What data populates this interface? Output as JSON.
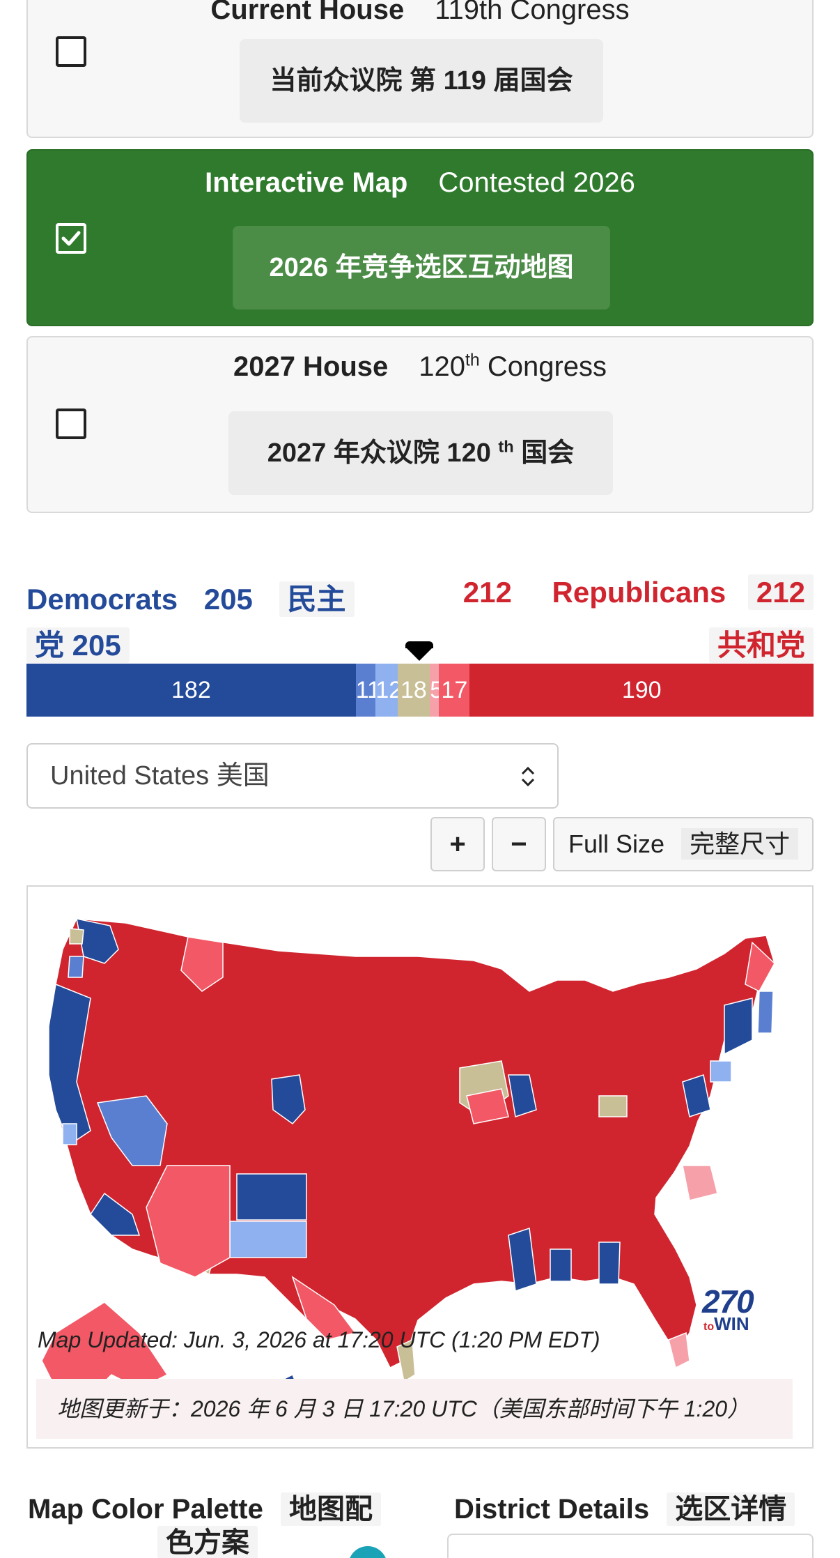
{
  "cards": [
    {
      "title_bold": "Current House",
      "title_rest": "119th Congress",
      "subtitle": "当前众议院 第 119 届国会",
      "selected": false
    },
    {
      "title_bold": "Interactive Map",
      "title_rest": "Contested 2026",
      "subtitle": "2026 年竞争选区互动地图",
      "selected": true
    },
    {
      "title_bold": "2027 House",
      "title_rest_pre": "120",
      "title_rest_sup": "th",
      "title_rest_post": " Congress",
      "subtitle_pre": "2027 年众议院 120 ",
      "subtitle_sup": "th",
      "subtitle_post": " 国会",
      "selected": false
    }
  ],
  "tally": {
    "dem_label": "Democrats",
    "dem_count": "205",
    "dem_zh_a": "民主",
    "dem_zh_b": "党 205",
    "rep_count_left": "212",
    "rep_label": "Republicans",
    "rep_count": "212",
    "rep_zh": "共和党"
  },
  "seat_bar": [
    {
      "label": "182",
      "value": 182,
      "color": "#244a9a"
    },
    {
      "label": "11",
      "value": 11,
      "color": "#5b7fd0"
    },
    {
      "label": "12",
      "value": 12,
      "color": "#8fb1f0"
    },
    {
      "label": "18",
      "value": 18,
      "color": "#c9bf97"
    },
    {
      "label": "5",
      "value": 5,
      "color": "#f6a0aa"
    },
    {
      "label": "17",
      "value": 17,
      "color": "#f25865"
    },
    {
      "label": "190",
      "value": 190,
      "color": "#d0252f"
    }
  ],
  "region_select": {
    "value": "United States  美国"
  },
  "controls": {
    "zoom_in": "+",
    "zoom_out": "−",
    "full_size": "Full Size",
    "full_size_zh": "完整尺寸"
  },
  "map": {
    "updated_en": "Map Updated: Jun. 3, 2026 at 17:20 UTC (1:20 PM EDT)",
    "updated_zh": "地图更新于：2026 年 6 月 3 日 17:20 UTC（美国东部时间下午 1:20）",
    "logo_number": "270",
    "logo_to": "to",
    "logo_win": "WIN",
    "colors": {
      "safe_dem": "#244a9a",
      "likely_dem": "#5b7fd0",
      "lean_dem": "#8fb1f0",
      "tossup": "#c9bf97",
      "lean_rep": "#f6a0aa",
      "likely_rep": "#f25865",
      "safe_rep": "#d0252f"
    }
  },
  "bottom": {
    "palette_title": "Map Color Palette",
    "palette_title_zh_a": "地图配",
    "palette_title_zh_b": "色方案",
    "details_title": "District Details",
    "details_title_zh": "选区详情"
  }
}
